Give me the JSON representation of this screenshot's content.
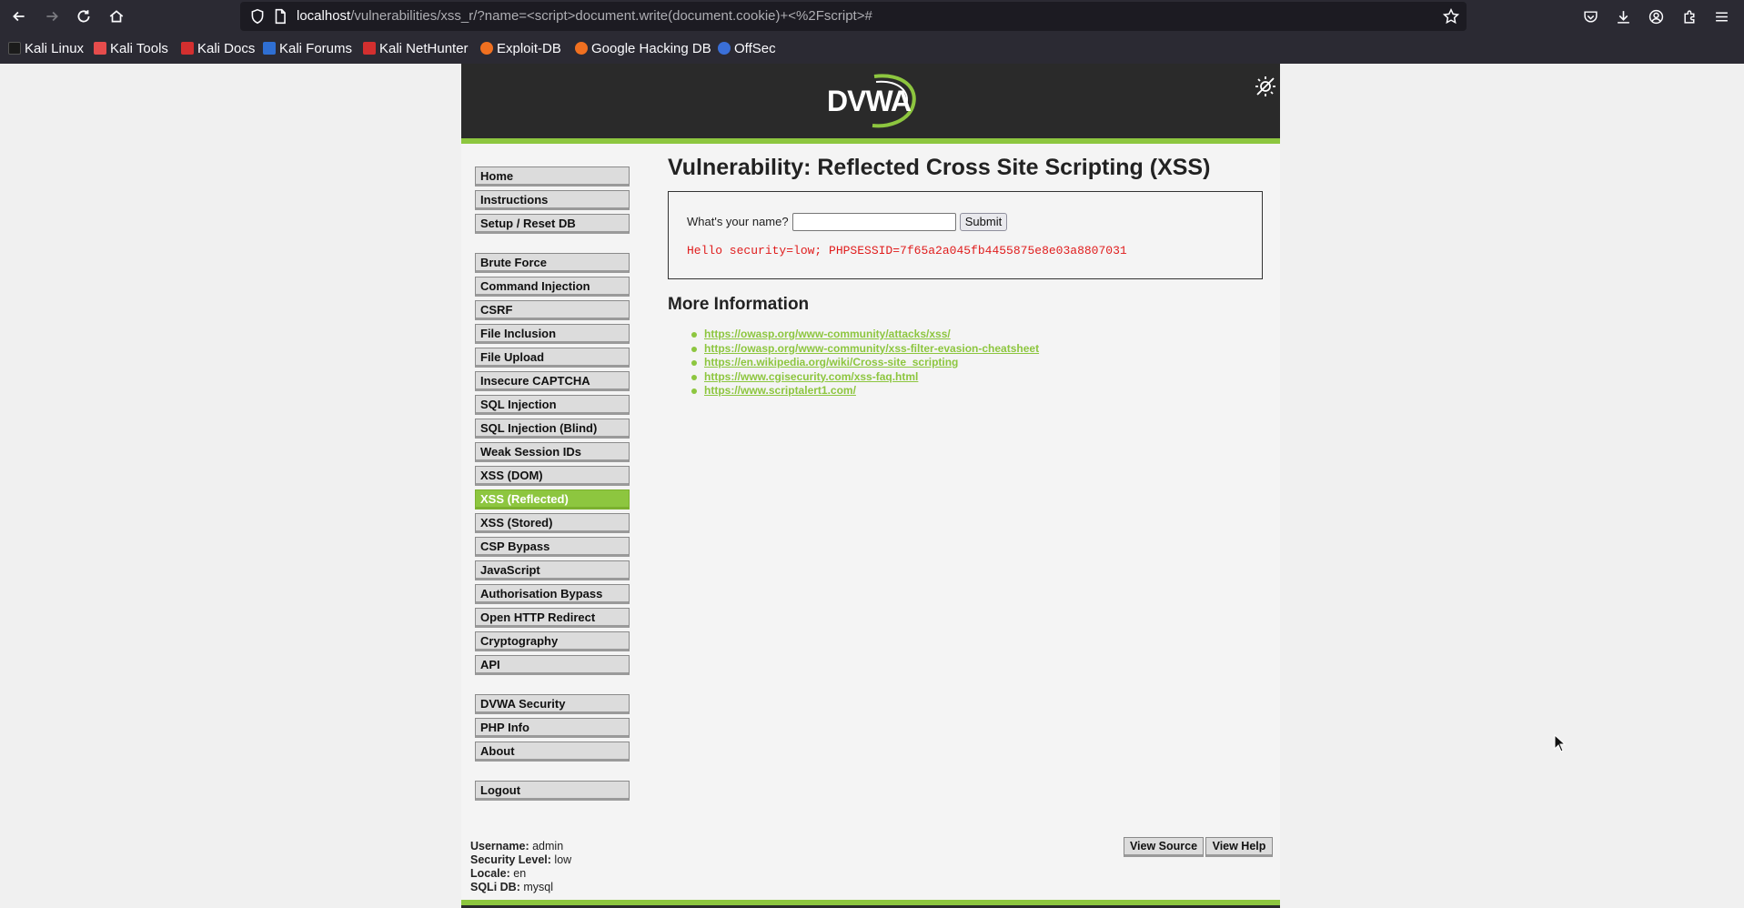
{
  "browser": {
    "url_host": "localhost",
    "url_path": "/vulnerabilities/xss_r/?name=<script>document.write(document.cookie)+<%2Fscript>#",
    "nav_icons": [
      "back-icon",
      "forward-icon",
      "reload-icon",
      "home-icon"
    ],
    "right_icons": [
      "pocket-icon",
      "downloads-icon",
      "account-icon",
      "extensions-icon",
      "menu-icon"
    ]
  },
  "bookmarks": [
    {
      "label": "Kali Linux",
      "color": "#1b1b1b"
    },
    {
      "label": "Kali Tools",
      "color": "#e64c4c"
    },
    {
      "label": "Kali Docs",
      "color": "#d32f2f"
    },
    {
      "label": "Kali Forums",
      "color": "#2f6fd3"
    },
    {
      "label": "Kali NetHunter",
      "color": "#d32f2f"
    },
    {
      "label": "Exploit-DB",
      "color": "#f07020"
    },
    {
      "label": "Google Hacking DB",
      "color": "#f07020"
    },
    {
      "label": "OffSec",
      "color": "#3a6fd8"
    }
  ],
  "dvwa": {
    "logo_text": "DVWA",
    "accent_color": "#8dc63f",
    "menu_group_1": [
      "Home",
      "Instructions",
      "Setup / Reset DB"
    ],
    "menu_group_2": [
      "Brute Force",
      "Command Injection",
      "CSRF",
      "File Inclusion",
      "File Upload",
      "Insecure CAPTCHA",
      "SQL Injection",
      "SQL Injection (Blind)",
      "Weak Session IDs",
      "XSS (DOM)",
      "XSS (Reflected)",
      "XSS (Stored)",
      "CSP Bypass",
      "JavaScript",
      "Authorisation Bypass",
      "Open HTTP Redirect",
      "Cryptography",
      "API"
    ],
    "menu_group_3": [
      "DVWA Security",
      "PHP Info",
      "About"
    ],
    "menu_group_4": [
      "Logout"
    ],
    "active_item": "XSS (Reflected)"
  },
  "main": {
    "title": "Vulnerability: Reflected Cross Site Scripting (XSS)",
    "question_label": "What's your name?",
    "name_value": "",
    "submit_label": "Submit",
    "output": "Hello security=low; PHPSESSID=7f65a2a045fb4455875e8e03a8807031",
    "more_info_heading": "More Information",
    "links": [
      "https://owasp.org/www-community/attacks/xss/",
      "https://owasp.org/www-community/xss-filter-evasion-cheatsheet",
      "https://en.wikipedia.org/wiki/Cross-site_scripting",
      "https://www.cgisecurity.com/xss-faq.html",
      "https://www.scriptalert1.com/"
    ]
  },
  "footer": {
    "username_label": "Username:",
    "username": "admin",
    "security_label": "Security Level:",
    "security": "low",
    "locale_label": "Locale:",
    "locale": "en",
    "sqli_label": "SQLi DB:",
    "sqli": "mysql",
    "view_source": "View Source",
    "view_help": "View Help"
  }
}
